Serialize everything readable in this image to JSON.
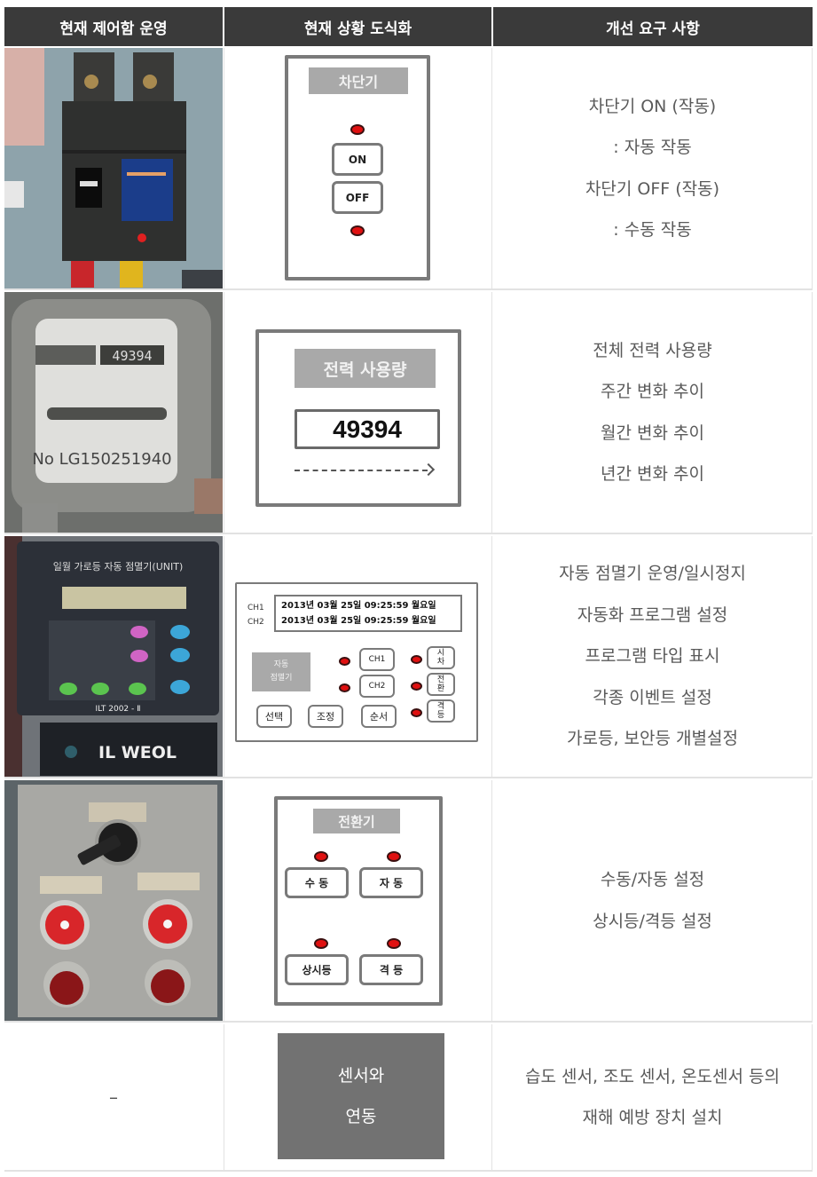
{
  "header": {
    "col1": "현재 제어함 운영",
    "col2": "현재 상황 도식화",
    "col3": "개선 요구 사항"
  },
  "rows": [
    {
      "photo": "circuit-breaker-photo",
      "diagram": {
        "title": "차단기",
        "buttons": [
          "ON",
          "OFF"
        ]
      },
      "requirements": [
        "차단기 ON (작동)",
        ": 자동 작동",
        "차단기 OFF (작동)",
        ": 수동 작동"
      ]
    },
    {
      "photo": "power-meter-photo",
      "photo_text": {
        "counter": "49394",
        "serial": "No LG150251940"
      },
      "diagram": {
        "title": "전력 사용량",
        "value": "49394"
      },
      "requirements": [
        "전체 전력 사용량",
        "주간 변화 추이",
        "월간 변화 추이",
        "년간 변화 추이"
      ]
    },
    {
      "photo": "auto-timer-photo",
      "photo_text": {
        "title": "일월 가로등 자동 점멸기(UNIT)",
        "model": "ILT 2002 - Ⅱ",
        "brand": "IL WEOL"
      },
      "diagram": {
        "ch1_label": "CH1",
        "ch2_label": "CH2",
        "ch1_display": "2013년 03월  25일  09:25:59 월요일",
        "ch2_display": "2013년 03월  25일  09:25:59 월요일",
        "unit_label_line1": "자동",
        "unit_label_line2": "점멸기",
        "ch_buttons": [
          "CH1",
          "CH2"
        ],
        "side_buttons": [
          [
            "시",
            "차"
          ],
          [
            "전",
            "환"
          ],
          [
            "격",
            "등"
          ]
        ],
        "bottom_buttons": [
          "선택",
          "조정",
          "순서"
        ]
      },
      "requirements": [
        "자동 점멸기 운영/일시정지",
        "자동화 프로그램 설정",
        "프로그램 타입 표시",
        "각종 이벤트 설정",
        "가로등, 보안등 개별설정"
      ]
    },
    {
      "photo": "switch-panel-photo",
      "diagram": {
        "title": "전환기",
        "buttons": [
          "수 동",
          "자 동",
          "상시등",
          "격  등"
        ]
      },
      "requirements": [
        "수동/자동 설정",
        "상시등/격등 설정"
      ]
    },
    {
      "photo_placeholder": "–",
      "diagram": {
        "line1": "센서와",
        "line2": "연동"
      },
      "requirements": [
        "습도 센서, 조도 센서, 온도센서 등의",
        "재해 예방 장치 설치"
      ]
    }
  ],
  "colors": {
    "header_bg": "#3a3a3a",
    "led_red": "#e01010",
    "label_gray": "#a9a9a9",
    "sensor_box": "#727272"
  }
}
